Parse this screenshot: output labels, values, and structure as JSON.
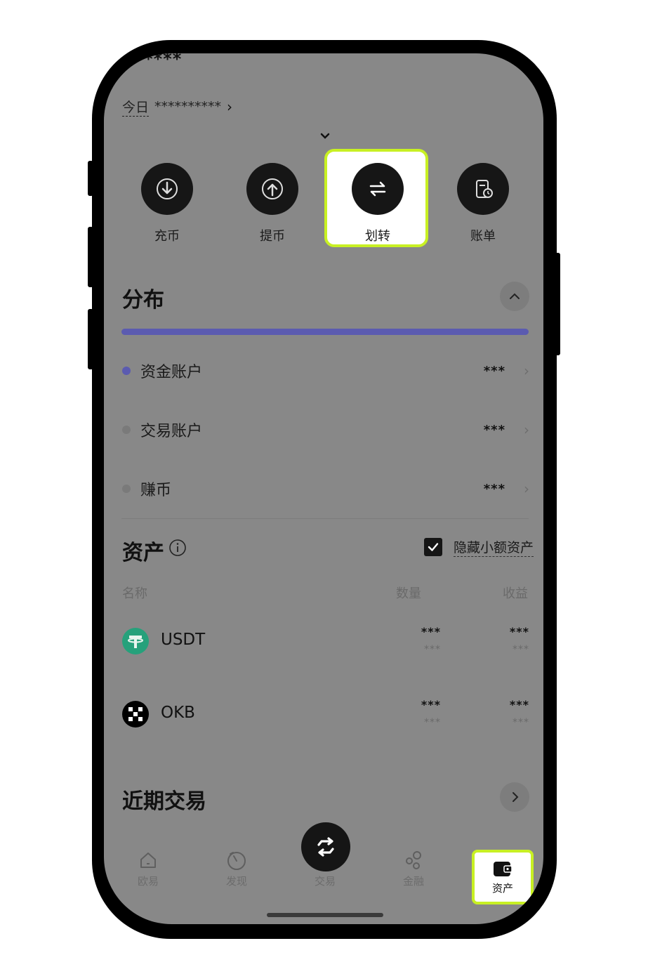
{
  "header": {
    "masked_total": "******",
    "today_label": "今日",
    "today_value": "**********"
  },
  "actions": [
    {
      "label": "充币",
      "icon": "deposit-icon"
    },
    {
      "label": "提币",
      "icon": "withdraw-icon"
    },
    {
      "label": "划转",
      "icon": "transfer-icon",
      "highlighted": true
    },
    {
      "label": "账单",
      "icon": "bill-icon"
    }
  ],
  "distribution": {
    "title": "分布",
    "bar_color": "#5b5bb0",
    "accounts": [
      {
        "name": "资金账户",
        "value": "***",
        "dot_color": "#5b5bb0"
      },
      {
        "name": "交易账户",
        "value": "***",
        "dot_color": "#7a7a7a"
      },
      {
        "name": "赚币",
        "value": "***",
        "dot_color": "#7a7a7a"
      }
    ]
  },
  "assets": {
    "title": "资产",
    "hide_small_label": "隐藏小额资产",
    "hide_small_checked": true,
    "columns": {
      "name": "名称",
      "quantity": "数量",
      "pnl": "收益"
    },
    "rows": [
      {
        "symbol": "USDT",
        "qty_main": "***",
        "qty_sub": "***",
        "pnl_main": "***",
        "pnl_sub": "***",
        "icon": "usdt-icon",
        "icon_color": "#26a17b"
      },
      {
        "symbol": "OKB",
        "qty_main": "***",
        "qty_sub": "***",
        "pnl_main": "***",
        "pnl_sub": "***",
        "icon": "okb-icon",
        "icon_color": "#000000"
      }
    ]
  },
  "recent": {
    "title": "近期交易"
  },
  "tabbar": [
    {
      "label": "欧易",
      "icon": "home-icon"
    },
    {
      "label": "发现",
      "icon": "discover-icon"
    },
    {
      "label": "交易",
      "icon": "trade-icon"
    },
    {
      "label": "金融",
      "icon": "finance-icon"
    },
    {
      "label": "资产",
      "icon": "wallet-icon",
      "active": true
    }
  ],
  "colors": {
    "highlight": "#c8f023",
    "overlay": "#888888"
  }
}
